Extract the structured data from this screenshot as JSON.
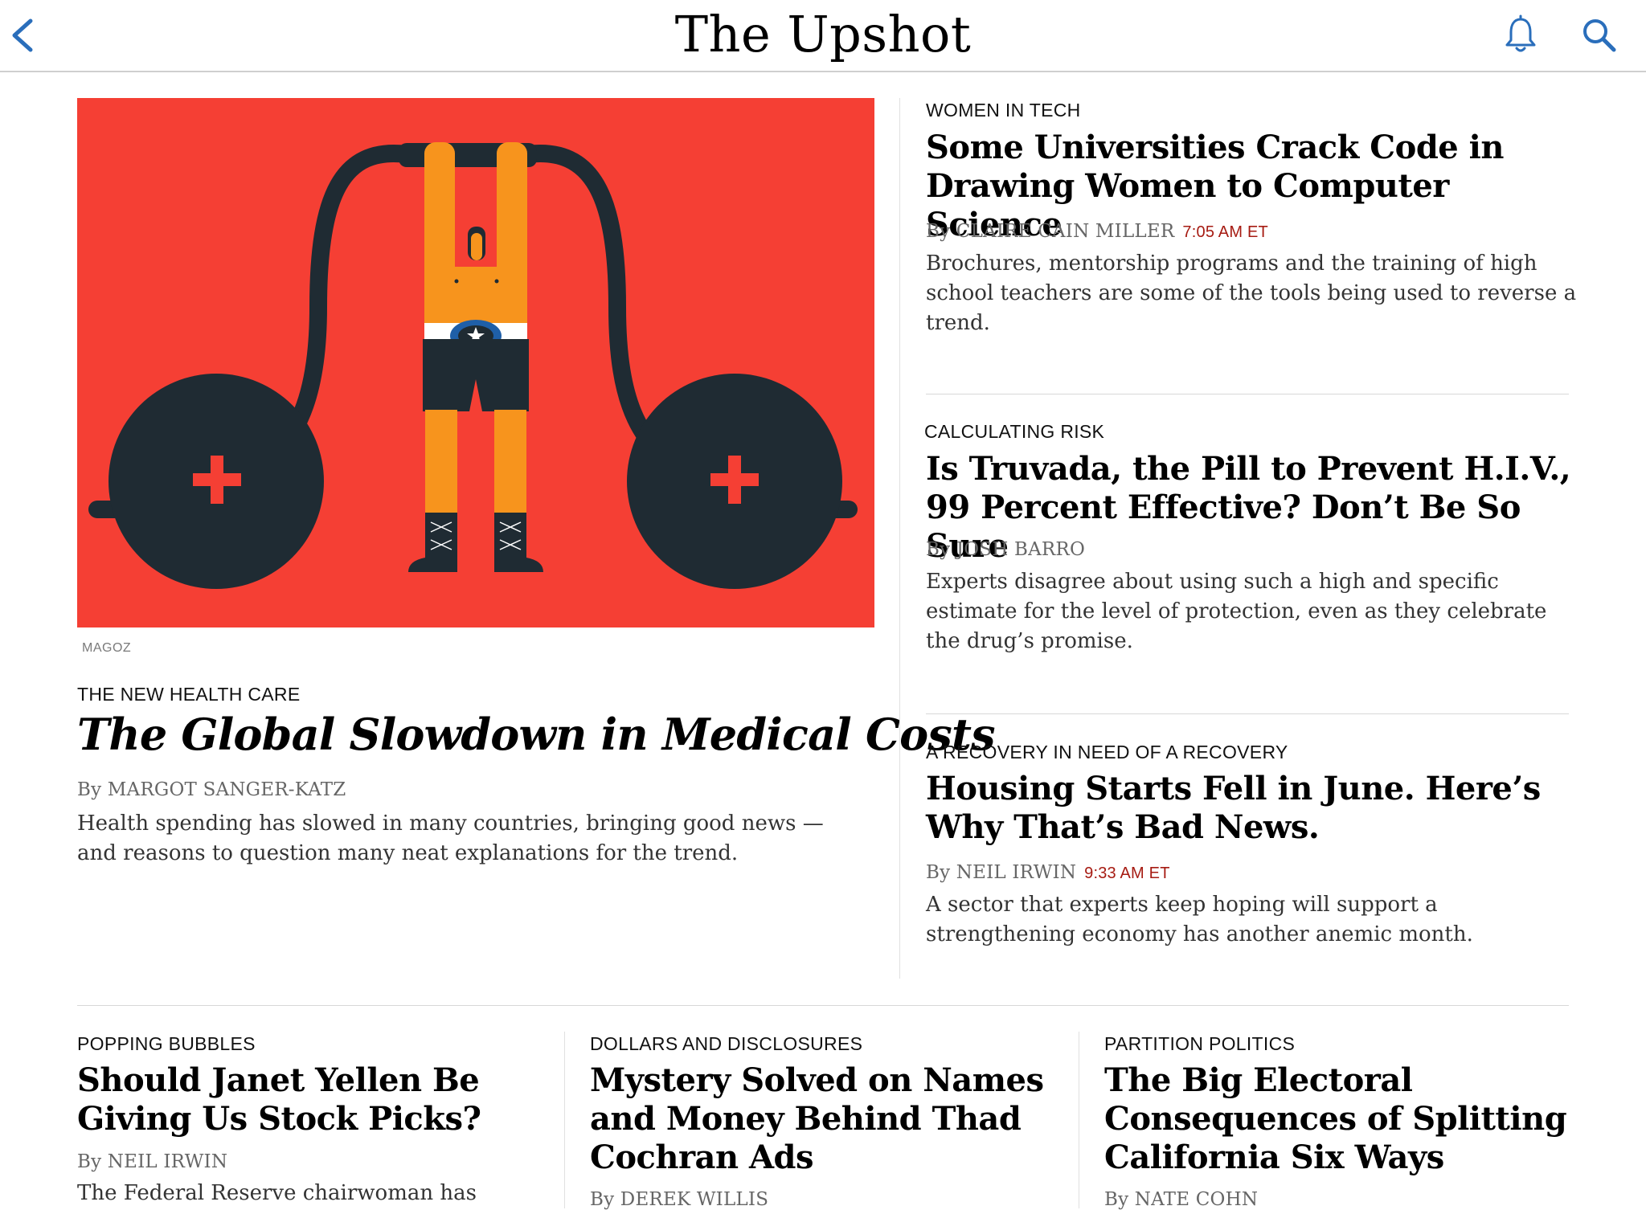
{
  "header": {
    "title": "The Upshot",
    "accent_color": "#2a6ebb",
    "back_icon": "chevron-left-icon",
    "bell_icon": "bell-icon",
    "search_icon": "search-icon"
  },
  "lead": {
    "image_credit": "MAGOZ",
    "image_background": "#f53f34",
    "kicker": "THE NEW HEALTH CARE",
    "headline": "The Global Slowdown in Medical Costs",
    "byline": "By MARGOT SANGER-KATZ",
    "summary": "Health spending has slowed in many countries, bringing good news — and reasons to question many neat explanations for the trend."
  },
  "side_stories": [
    {
      "kicker": "WOMEN IN TECH",
      "headline": "Some Universities Crack Code in Drawing Women to Computer Science",
      "byline": "By CLAIRE CAIN MILLER",
      "time": "7:05 AM ET",
      "summary": "Brochures, mentorship programs and the training of high school teachers are some of the tools being used to reverse a trend."
    },
    {
      "kicker": "CALCULATING RISK",
      "headline": "Is Truvada, the Pill to Prevent H.I.V., 99 Percent Effective? Don’t Be So Sure",
      "byline": "By JOSH BARRO",
      "summary": "Experts disagree about using such a high and specific estimate for the level of protection, even as they celebrate the drug’s promise."
    },
    {
      "kicker": "A RECOVERY IN NEED OF A RECOVERY",
      "headline": "Housing Starts Fell in June. Here’s Why That’s Bad News.",
      "byline": "By NEIL IRWIN",
      "time": "9:33 AM ET",
      "summary": "A sector that experts keep hoping will support a strengthening economy has another anemic month."
    }
  ],
  "bottom_stories": [
    {
      "kicker": "POPPING BUBBLES",
      "headline": "Should Janet Yellen Be Giving Us Stock Picks?",
      "byline": "By NEIL IRWIN",
      "summary": "The Federal Reserve chairwoman has"
    },
    {
      "kicker": "DOLLARS AND DISCLOSURES",
      "headline": "Mystery Solved on Names and Money Behind Thad Cochran Ads",
      "byline": "By DEREK WILLIS"
    },
    {
      "kicker": "PARTITION POLITICS",
      "headline": "The Big Electoral Consequences of Splitting California Six Ways",
      "byline": "By NATE COHN"
    }
  ]
}
